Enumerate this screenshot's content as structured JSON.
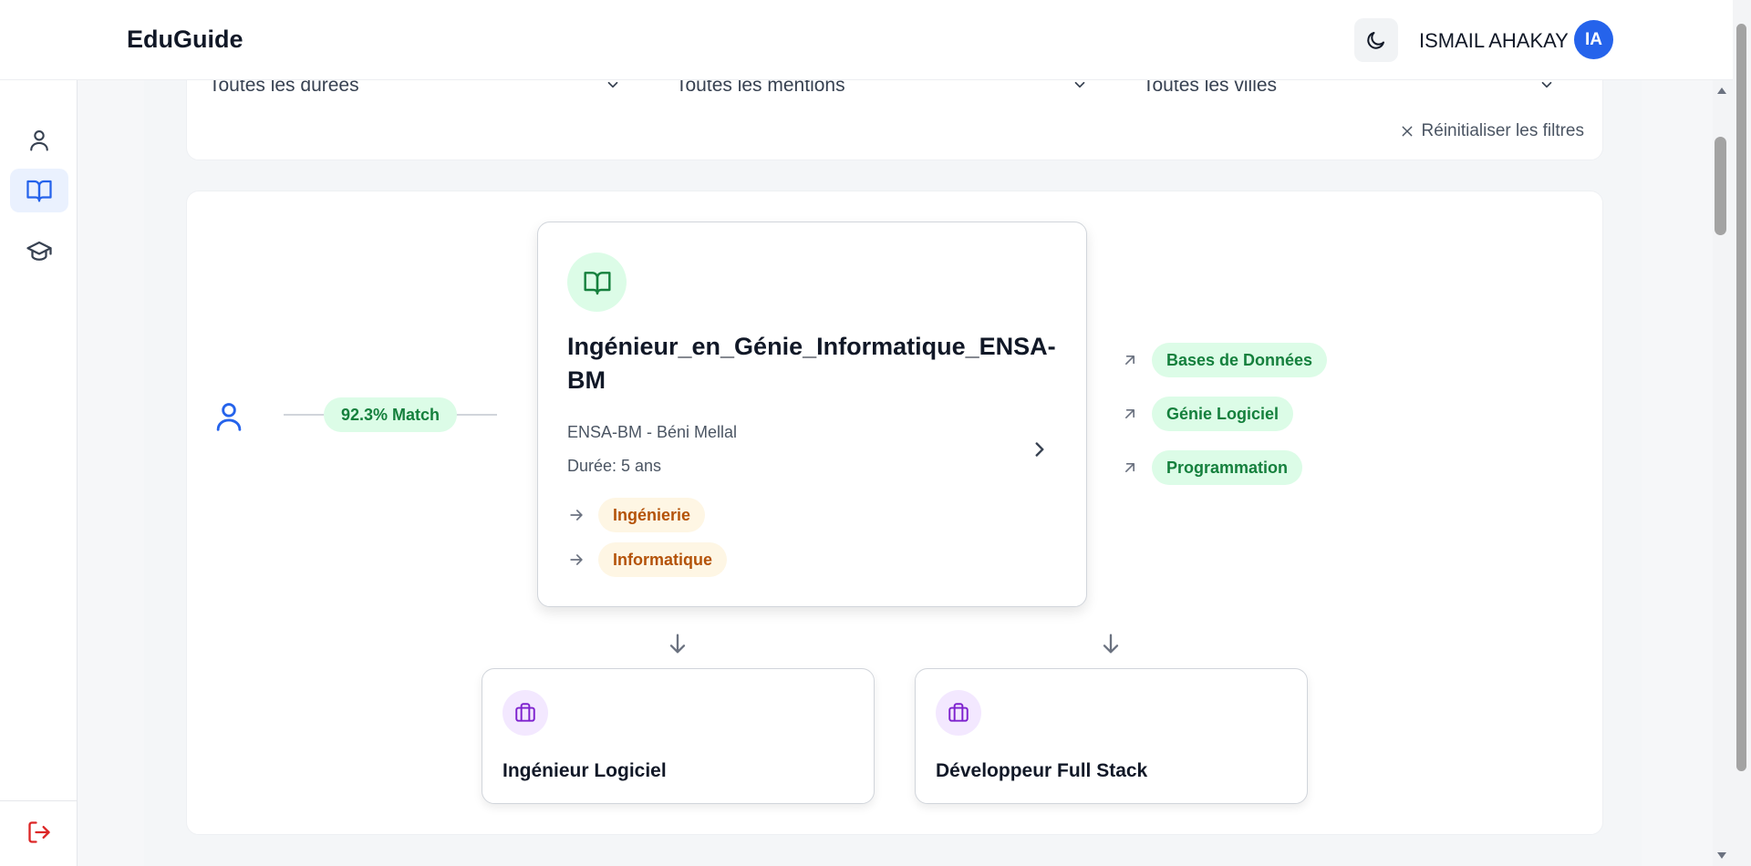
{
  "app": {
    "brand": "EduGuide"
  },
  "header": {
    "username": "ISMAIL AHAKAY",
    "avatar_initials": "IA"
  },
  "sidebar": {
    "items": [
      {
        "name": "profile",
        "icon": "user-icon",
        "active": false
      },
      {
        "name": "programs",
        "icon": "book-open-icon",
        "active": true
      },
      {
        "name": "schools",
        "icon": "graduation-cap-icon",
        "active": false
      }
    ],
    "logout_icon": "logout-icon"
  },
  "filters": {
    "duration": "Toutes les durées",
    "mention": "Toutes les mentions",
    "city": "Toutes les villes",
    "reset_label": "Réinitialiser les filtres"
  },
  "graph": {
    "match": "92.3% Match",
    "program": {
      "title": "Ingénieur_en_Génie_Informatique_ENSA-BM",
      "school": "ENSA-BM - Béni Mellal",
      "duration": "Durée: 5 ans",
      "domains": [
        "Ingénierie",
        "Informatique"
      ]
    },
    "skills": [
      "Bases de Données",
      "Génie Logiciel",
      "Programmation"
    ],
    "careers": [
      "Ingénieur Logiciel",
      "Développeur Full Stack"
    ]
  },
  "colors": {
    "accent": "#2563eb",
    "match_bg": "#dcfce7",
    "match_text": "#15803d",
    "domain_bg": "#fef6e4",
    "domain_text": "#b45309",
    "career_icon": "#7e22ce",
    "logout": "#dc2626"
  }
}
